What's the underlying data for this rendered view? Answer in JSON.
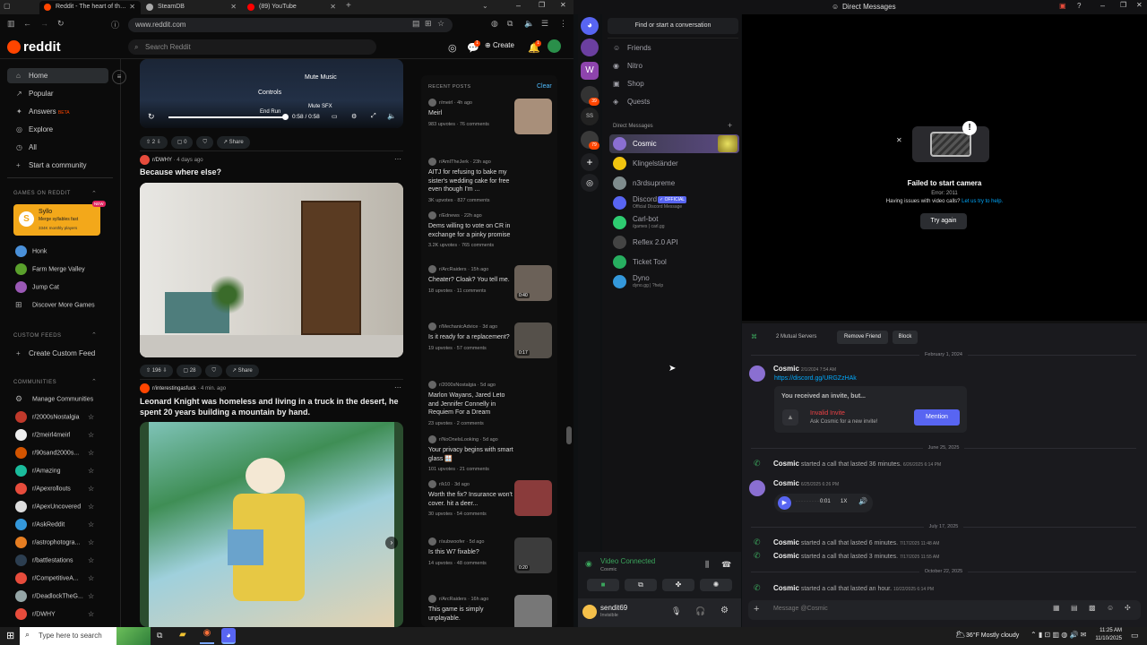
{
  "browser": {
    "tabs": [
      {
        "label": "Reddit - The heart of the intern",
        "color": "#ff4500"
      },
      {
        "label": "SteamDB",
        "color": "#aaaaaa"
      },
      {
        "label": "(89) YouTube",
        "color": "#ff0000"
      }
    ],
    "url": "www.reddit.com",
    "window_controls": [
      "–",
      "❐",
      "✕"
    ]
  },
  "reddit": {
    "logo": "reddit",
    "search_placeholder": "Search Reddit",
    "create_label": "Create",
    "chat_badge": "1",
    "inbox_badge": "1",
    "nav": [
      {
        "label": "Home",
        "icon": "⌂"
      },
      {
        "label": "Popular",
        "icon": "↗"
      },
      {
        "label": "Answers",
        "icon": "✦",
        "tag": "BETA"
      },
      {
        "label": "Explore",
        "icon": "◎"
      },
      {
        "label": "All",
        "icon": "◷"
      },
      {
        "label": "Start a community",
        "icon": "+"
      }
    ],
    "games_header": "GAMES ON REDDIT",
    "sylloh": {
      "title": "Syllo",
      "subtitle": "Merge syllables fast",
      "players": "334K monthly players",
      "new": "NEW"
    },
    "games": [
      {
        "label": "Honk",
        "color": "#4a90d9"
      },
      {
        "label": "Farm Merge Valley",
        "color": "#5aa02c"
      },
      {
        "label": "Jump Cat",
        "color": "#9b59b6"
      },
      {
        "label": "Discover More Games",
        "color": ""
      }
    ],
    "custom_feeds_header": "CUSTOM FEEDS",
    "create_custom_feed": "Create Custom Feed",
    "communities_header": "COMMUNITIES",
    "manage_communities": "Manage Communities",
    "communities": [
      {
        "name": "r/2000sNostalgia",
        "color": "#c0392b"
      },
      {
        "name": "r/2meirl4meirl",
        "color": "#eeeeee"
      },
      {
        "name": "r/90sand2000s...",
        "color": "#d35400"
      },
      {
        "name": "r/Amazing",
        "color": "#1abc9c"
      },
      {
        "name": "r/Apexrollouts",
        "color": "#e74c3c"
      },
      {
        "name": "r/ApexUncovered",
        "color": "#dddddd"
      },
      {
        "name": "r/AskReddit",
        "color": "#3498db"
      },
      {
        "name": "r/astrophotogra...",
        "color": "#e67e22"
      },
      {
        "name": "r/battlestations",
        "color": "#2c3e50"
      },
      {
        "name": "r/CompetitiveA...",
        "color": "#e74c3c"
      },
      {
        "name": "r/DeadlockTheG...",
        "color": "#95a5a6"
      },
      {
        "name": "r/DWHY",
        "color": "#e74c3c"
      }
    ],
    "video_post": {
      "overlay_labels": [
        "Mute Music",
        "Controls",
        "Mute SFX",
        "End Run"
      ],
      "time": "0:58 / 0:58",
      "upvotes": "2",
      "comments": "0",
      "share": "Share"
    },
    "post1": {
      "sub": "r/DWHY",
      "age": "4 days ago",
      "title": "Because where else?",
      "upvotes": "196",
      "comments": "28",
      "share": "Share"
    },
    "post2": {
      "sub": "r/interestingasfuck",
      "age": "4 min. ago",
      "title": "Leonard Knight was homeless and living in a truck in the desert, he spent 20 years building a mountain by hand."
    },
    "recent_header": "RECENT POSTS",
    "recent_clear": "Clear",
    "recent": [
      {
        "sub": "r/meirl",
        "age": "4h ago",
        "title": "Meirl",
        "stats": "983 upvotes · 76 comments",
        "thumb": "#a88f7a"
      },
      {
        "sub": "r/AmITheJerk",
        "age": "23h ago",
        "title": "AITJ for refusing to bake my sister's wedding cake for free even though I'm ...",
        "stats": "3K upvotes · 827 comments",
        "thumb": ""
      },
      {
        "sub": "r/Ednews",
        "age": "22h ago",
        "title": "Dems willing to vote on CR in exchange for a pinky promise",
        "stats": "3.2K upvotes · 765 comments",
        "thumb": ""
      },
      {
        "sub": "r/ArcRaiders",
        "age": "15h ago",
        "title": "Cheater? Cloak? You tell me.",
        "stats": "18 upvotes · 11 comments",
        "thumb": "#6b6158",
        "dur": "0:40"
      },
      {
        "sub": "r/MechanicAdvice",
        "age": "3d ago",
        "title": "Is it ready for a replacement?",
        "stats": "19 upvotes · 57 comments",
        "thumb": "#55504a",
        "dur": "0:17"
      },
      {
        "sub": "r/2000sNostalgia",
        "age": "5d ago",
        "title": "Marlon Wayans, Jared Leto and Jennifer Connelly in Requiem For a Dream",
        "stats": "23 upvotes · 2 comments",
        "thumb": ""
      },
      {
        "sub": "r/NoOnelsLooking",
        "age": "5d ago",
        "title": "Your privacy begins with smart glass 🪟",
        "stats": "101 upvotes · 21 comments",
        "thumb": ""
      },
      {
        "sub": "r/k10",
        "age": "3d ago",
        "title": "Worth the fix? Insurance won't cover. hit a deer...",
        "stats": "30 upvotes · 54 comments",
        "thumb": "#8a3b3b"
      },
      {
        "sub": "r/subwoofer",
        "age": "5d ago",
        "title": "Is this W7 fixable?",
        "stats": "14 upvotes · 48 comments",
        "thumb": "#3c3c3c",
        "dur": "0:20"
      },
      {
        "sub": "r/ArcRaiders",
        "age": "16h ago",
        "title": "This game is simply unplayable.",
        "stats": "",
        "thumb": "#777777"
      }
    ]
  },
  "discord": {
    "title": "Direct Messages",
    "find_placeholder": "Find or start a conversation",
    "top_nav": [
      {
        "label": "Friends",
        "icon": "☺"
      },
      {
        "label": "Nitro",
        "icon": "◉"
      },
      {
        "label": "Shop",
        "icon": "▣"
      },
      {
        "label": "Quests",
        "icon": "◈"
      }
    ],
    "dm_header": "Direct Messages",
    "dms": [
      {
        "name": "Cosmic",
        "sub": "",
        "color": "#8a6fd1"
      },
      {
        "name": "Klingelständer",
        "sub": "",
        "color": "#f1c40f"
      },
      {
        "name": "n3rdsupreme",
        "sub": "",
        "color": "#7f8c8d"
      },
      {
        "name": "Discord",
        "sub": "Official Discord Message",
        "color": "#5865f2",
        "tag": "✓ OFFICIAL"
      },
      {
        "name": "Carl-bot",
        "sub": "/games | carl.gg",
        "color": "#2ecc71"
      },
      {
        "name": "Reflex 2.0 API",
        "sub": "",
        "color": "#444444"
      },
      {
        "name": "Ticket Tool",
        "sub": "",
        "color": "#27ae60"
      },
      {
        "name": "Dyno",
        "sub": "dyno.gg | ?help",
        "color": "#3498db"
      }
    ],
    "server_badges": [
      "39",
      "79"
    ],
    "server_initials": "SS",
    "camera_error": {
      "title": "Failed to start camera",
      "code": "Error: 2011",
      "help": "Having issues with video calls?",
      "help_link": "Let us try to help.",
      "retry": "Try again"
    },
    "profile_bar": {
      "mutual": "2 Mutual Servers",
      "remove": "Remove Friend",
      "block": "Block"
    },
    "voice": {
      "status": "Video Connected",
      "channel": "Cosmic"
    },
    "user": {
      "name": "sendit69",
      "status": "Invisible"
    },
    "message_placeholder": "Message @Cosmic",
    "chat": {
      "dates": [
        "February 1, 2024",
        "June 25, 2025",
        "July 17, 2025",
        "October 22, 2025"
      ],
      "msg1": {
        "author": "Cosmic",
        "time": "2/1/2024 7:54 AM",
        "link": "https://discord.gg/URGZzHAk"
      },
      "invite": {
        "header": "You received an invite, but...",
        "title": "Invalid Invite",
        "subtitle": "Ask Cosmic for a new invite!",
        "button": "Mention"
      },
      "call1": {
        "author": "Cosmic",
        "text": "started a call that lasted 36 minutes.",
        "time": "6/26/2025 6:14 PM"
      },
      "voice_msg": {
        "author": "Cosmic",
        "time": "6/25/2025 6:26 PM",
        "duration": "0:01",
        "speed": "1X"
      },
      "call2": {
        "author": "Cosmic",
        "text": "started a call that lasted 6 minutes.",
        "time": "7/17/2025 11:48 AM"
      },
      "call3": {
        "author": "Cosmic",
        "text": "started a call that lasted 3 minutes.",
        "time": "7/17/2025 11:55 AM"
      },
      "call4": {
        "author": "Cosmic",
        "text": "started a call that lasted an hour.",
        "time": "10/22/2025 6:14 PM"
      }
    }
  },
  "taskbar": {
    "search": "Type here to search",
    "weather": "36°F  Mostly cloudy",
    "time": "11:25 AM",
    "date": "11/10/2025"
  }
}
